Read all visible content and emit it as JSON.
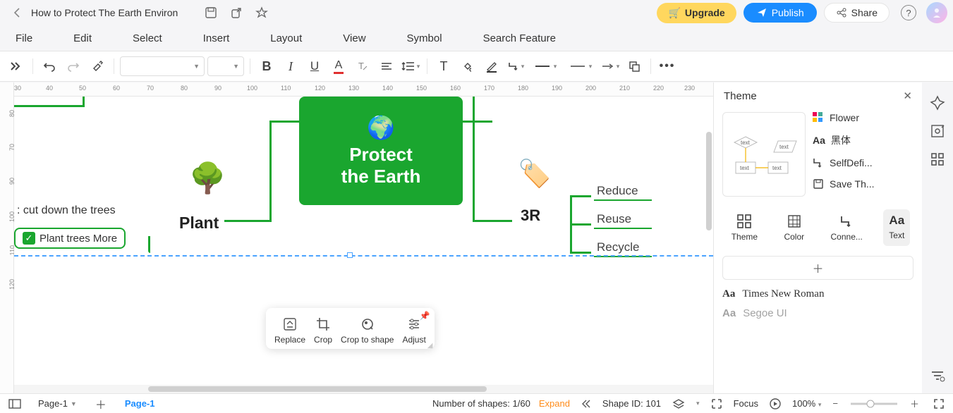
{
  "title": "How to Protect The Earth Environ",
  "header": {
    "upgrade": "Upgrade",
    "publish": "Publish",
    "share": "Share"
  },
  "menu": [
    "File",
    "Edit",
    "Select",
    "Insert",
    "Layout",
    "View",
    "Symbol",
    "Search Feature"
  ],
  "ruler_h": [
    30,
    40,
    50,
    60,
    70,
    80,
    90,
    100,
    110,
    120,
    130,
    140,
    150,
    160,
    170,
    180,
    190,
    200,
    210,
    220,
    230
  ],
  "ruler_v": [
    80,
    70,
    90,
    100,
    110,
    120
  ],
  "mindmap": {
    "main_line1": "Protect",
    "main_line2": "the Earth",
    "plant": "Plant",
    "cut": ": cut down the trees",
    "plant_more": "Plant trees More",
    "r3": "3R",
    "r_items": [
      "Reduce",
      "Reuse",
      "Recycle"
    ]
  },
  "ctx": {
    "replace": "Replace",
    "crop": "Crop",
    "crop_shape": "Crop to shape",
    "adjust": "Adjust"
  },
  "theme_panel": {
    "title": "Theme",
    "flower": "Flower",
    "heiti": "黑体",
    "selfdef": "SelfDefi...",
    "save": "Save Th...",
    "tabs": {
      "theme": "Theme",
      "color": "Color",
      "conn": "Conne...",
      "text": "Text"
    },
    "fonts": [
      "Times New Roman",
      "Segoe UI"
    ],
    "preview_text": "text"
  },
  "status": {
    "page_dd": "Page-1",
    "page_tab": "Page-1",
    "shapes_label": "Number of shapes:",
    "shapes_count": "1/60",
    "expand": "Expand",
    "shape_id": "Shape ID: 101",
    "focus": "Focus",
    "zoom": "100%"
  }
}
